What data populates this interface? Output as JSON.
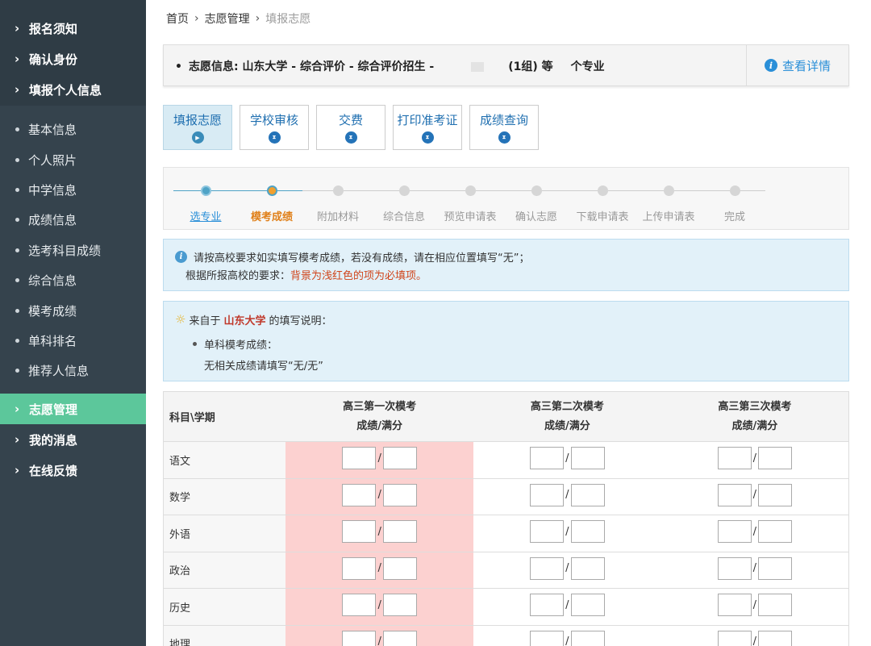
{
  "sidebar": {
    "top_items": [
      {
        "label": "报名须知"
      },
      {
        "label": "确认身份"
      },
      {
        "label": "填报个人信息"
      }
    ],
    "sub_items": [
      {
        "label": "基本信息"
      },
      {
        "label": "个人照片"
      },
      {
        "label": "中学信息"
      },
      {
        "label": "成绩信息"
      },
      {
        "label": "选考科目成绩"
      },
      {
        "label": "综合信息"
      },
      {
        "label": "模考成绩"
      },
      {
        "label": "单科排名"
      },
      {
        "label": "推荐人信息"
      }
    ],
    "bottom_items": [
      {
        "label": "志愿管理",
        "active": true
      },
      {
        "label": "我的消息"
      },
      {
        "label": "在线反馈"
      }
    ]
  },
  "breadcrumb": {
    "home": "首页",
    "section": "志愿管理",
    "current": "填报志愿"
  },
  "info": {
    "label": "志愿信息:",
    "value": "山东大学 - 综合评价 - 综合评价招生 -",
    "group": "(1组)",
    "mid": "等",
    "tail": "个专业",
    "link": "查看详情"
  },
  "tabs": [
    {
      "label": "填报志愿",
      "active": true
    },
    {
      "label": "学校审核"
    },
    {
      "label": "交费"
    },
    {
      "label": "打印准考证"
    },
    {
      "label": "成绩查询"
    }
  ],
  "progress_steps": [
    {
      "label": "选专业",
      "state": "done"
    },
    {
      "label": "模考成绩",
      "state": "current"
    },
    {
      "label": "附加材料",
      "state": "todo"
    },
    {
      "label": "综合信息",
      "state": "todo"
    },
    {
      "label": "预览申请表",
      "state": "todo"
    },
    {
      "label": "确认志愿",
      "state": "todo"
    },
    {
      "label": "下载申请表",
      "state": "todo"
    },
    {
      "label": "上传申请表",
      "state": "todo"
    },
    {
      "label": "完成",
      "state": "todo"
    }
  ],
  "notice": {
    "line1": "请按高校要求如实填写模考成绩，若没有成绩，请在相应位置填写“无”；",
    "line2_prefix": "根据所报高校的要求：",
    "line2_red": "背景为浅红色的项为必填项。"
  },
  "tips": {
    "prefix": "来自于",
    "university": "山东大学",
    "suffix": "的填写说明：",
    "item_title": "单科模考成绩：",
    "item_text": "无相关成绩请填写“无/无”"
  },
  "table": {
    "corner_header": "科目\\学期",
    "columns": [
      {
        "line1": "高三第一次模考",
        "line2": "成绩/满分",
        "required": true
      },
      {
        "line1": "高三第二次模考",
        "line2": "成绩/满分",
        "required": false
      },
      {
        "line1": "高三第三次模考",
        "line2": "成绩/满分",
        "required": false
      }
    ],
    "slash": "/",
    "rows": [
      {
        "subject": "语文"
      },
      {
        "subject": "数学"
      },
      {
        "subject": "外语"
      },
      {
        "subject": "政治"
      },
      {
        "subject": "历史"
      },
      {
        "subject": "地理"
      }
    ]
  },
  "colors": {
    "sidebar_bg": "#35434d",
    "active_green": "#5cc79b",
    "link_blue": "#2a8fd8",
    "required_bg": "#fcd1d0",
    "current_step_orange": "#e0801a"
  }
}
